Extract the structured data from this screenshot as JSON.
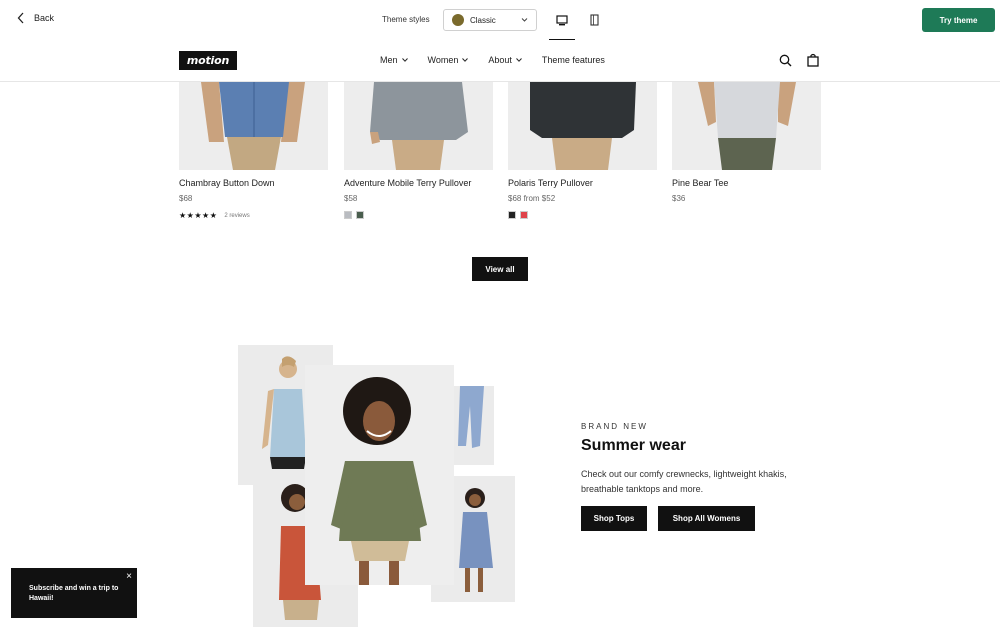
{
  "editor": {
    "back_label": "Back",
    "theme_styles_label": "Theme styles",
    "selected_style": "Classic",
    "selected_style_color": "#7a6a2c",
    "try_theme_label": "Try theme",
    "accent_color": "#1e7a57"
  },
  "header": {
    "logo": "motion",
    "nav": [
      "Men",
      "Women",
      "About",
      "Theme features"
    ]
  },
  "products": [
    {
      "name": "Chambray Button Down",
      "price": "$68",
      "stars": "★★★★★",
      "reviews": "2 reviews"
    },
    {
      "name": "Adventure Mobile Terry Pullover",
      "price": "$58",
      "swatches": [
        "#b9bcc1",
        "#4a5e4e"
      ]
    },
    {
      "name": "Polaris Terry Pullover",
      "price": "$68 from $52",
      "swatches": [
        "#222222",
        "#e0434b"
      ]
    },
    {
      "name": "Pine Bear Tee",
      "price": "$36"
    }
  ],
  "view_all_label": "View all",
  "promo": {
    "eyebrow": "BRAND NEW",
    "title": "Summer wear",
    "description": "Check out our comfy crewnecks, lightweight khakis, breathable tanktops and more.",
    "button_tops": "Shop Tops",
    "button_womens": "Shop All Womens"
  },
  "popup": {
    "text": "Subscribe and win a trip to Hawaii!",
    "close": "×"
  }
}
